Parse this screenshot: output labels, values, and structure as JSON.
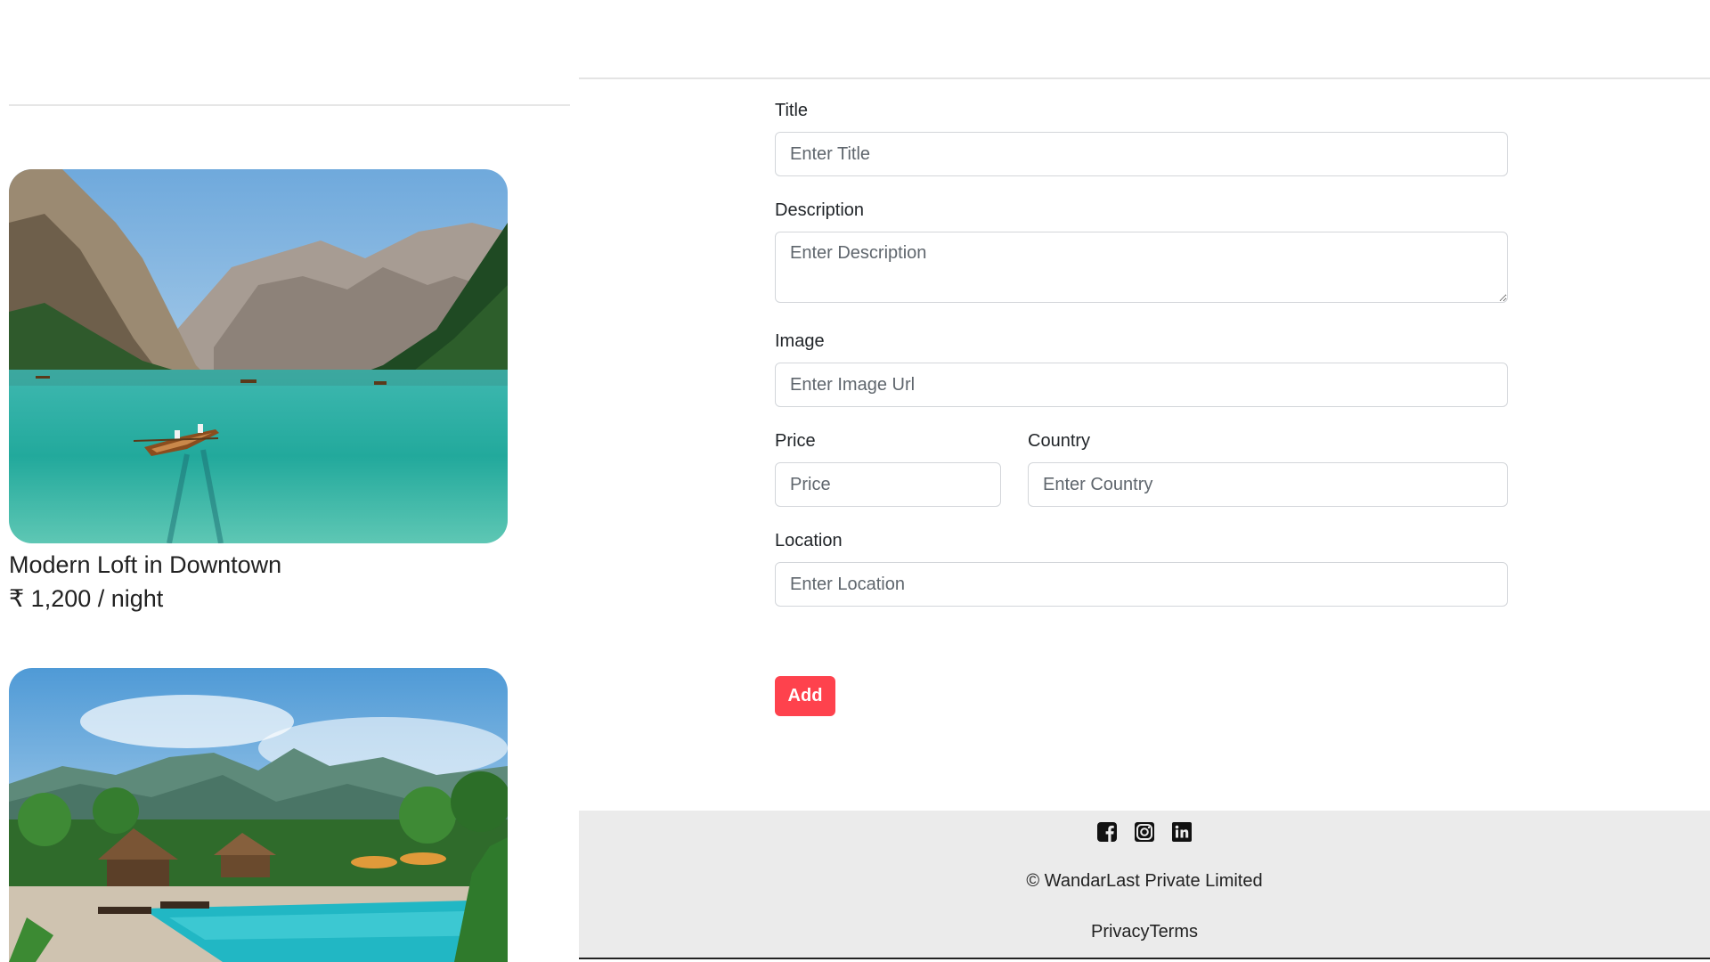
{
  "listings": [
    {
      "title": "Modern Loft in Downtown",
      "price": "₹ 1,200 / night",
      "image_subject": "mountain-lake-with-boat"
    },
    {
      "image_subject": "tropical-resort-pool"
    }
  ],
  "form": {
    "title": {
      "label": "Title",
      "placeholder": "Enter Title"
    },
    "description": {
      "label": "Description",
      "placeholder": "Enter Description"
    },
    "image": {
      "label": "Image",
      "placeholder": "Enter Image Url"
    },
    "price": {
      "label": "Price",
      "placeholder": "Price"
    },
    "country": {
      "label": "Country",
      "placeholder": "Enter Country"
    },
    "location": {
      "label": "Location",
      "placeholder": "Enter Location"
    },
    "submit_label": "Add"
  },
  "footer": {
    "social_icons": [
      "facebook-icon",
      "instagram-icon",
      "linkedin-icon"
    ],
    "copyright": "© WandarLast Private Limited",
    "links": [
      "Privacy",
      "Terms"
    ]
  },
  "colors": {
    "accent": "#fe424d",
    "footer_bg": "#ebebeb",
    "divider": "#e4e4e4"
  }
}
